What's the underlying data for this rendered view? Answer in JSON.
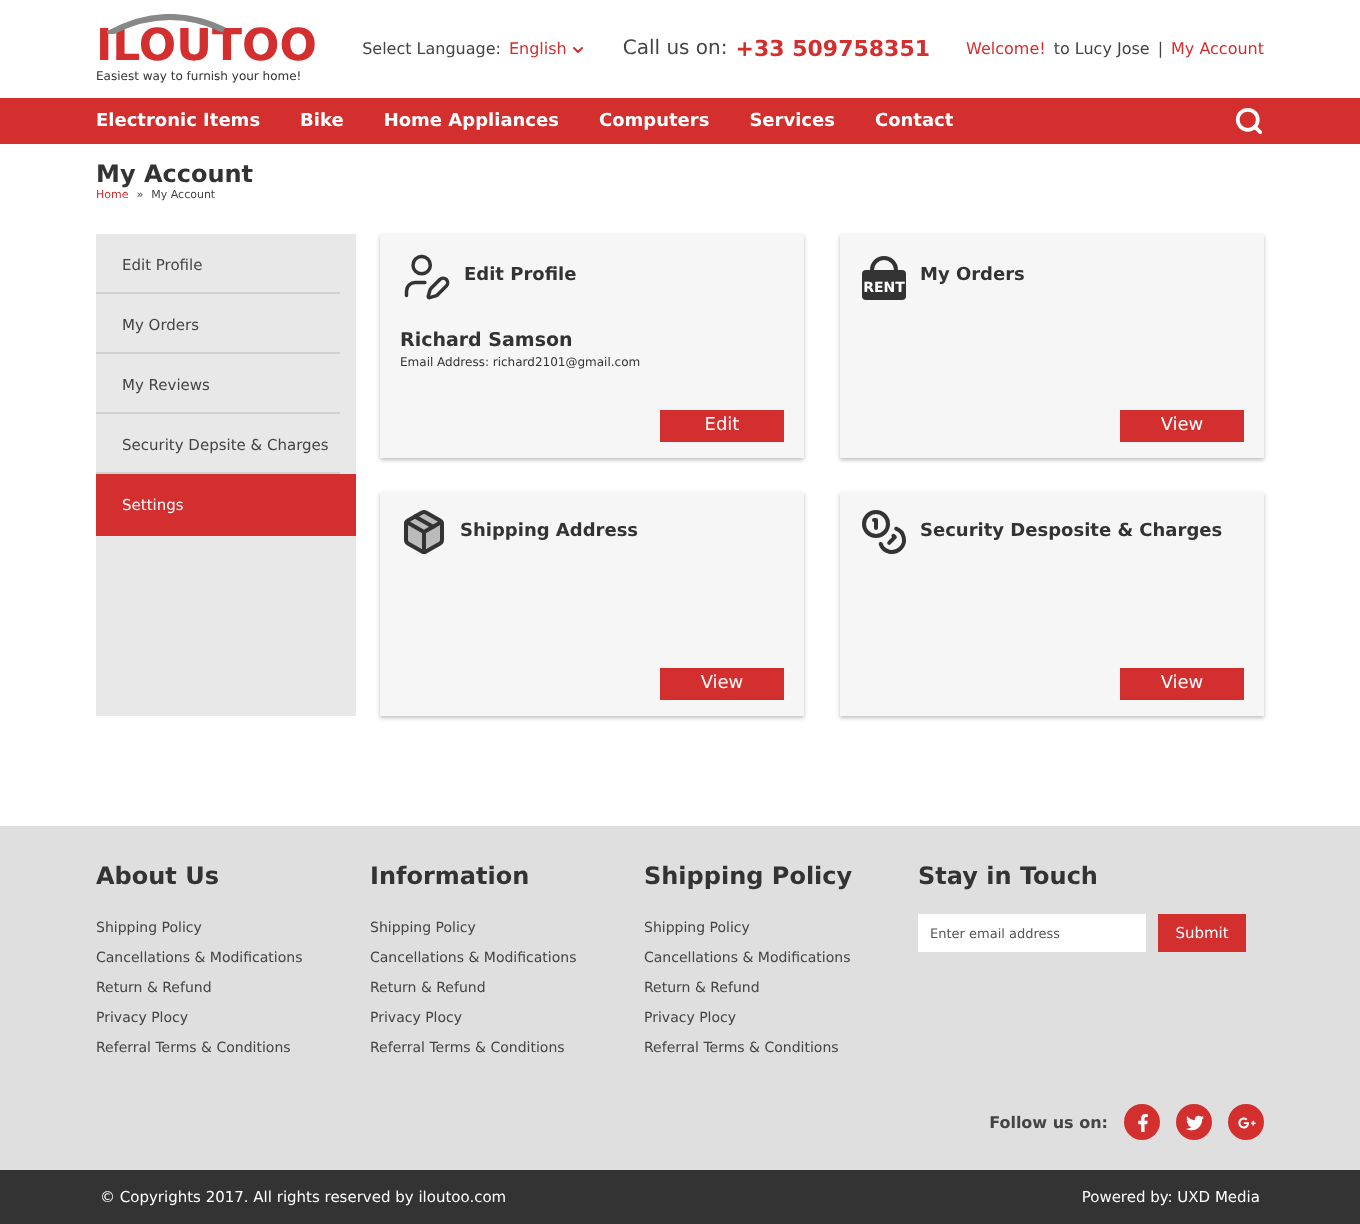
{
  "logo": {
    "name": "ILOUTOO",
    "tagline": "Easiest way to furnish your home!"
  },
  "header": {
    "language_label": "Select Language:",
    "language": "English",
    "call_label": "Call us on:",
    "phone": "+33 509758351",
    "welcome": "Welcome!",
    "welcome_rest": "to Lucy Jose",
    "separator": "|",
    "account_link": "My Account"
  },
  "nav": {
    "items": [
      "Electronic Items",
      "Bike",
      "Home Appliances",
      "Computers",
      "Services",
      "Contact"
    ]
  },
  "page": {
    "title": "My Account",
    "breadcrumb": [
      {
        "label": "Home",
        "link": true
      },
      {
        "label": "»",
        "link": false
      },
      {
        "label": "My Account",
        "link": false
      }
    ]
  },
  "sidebar": {
    "items": [
      {
        "label": "Edit Profile",
        "selected": false
      },
      {
        "label": "My Orders",
        "selected": false
      },
      {
        "label": "My Reviews",
        "selected": false
      },
      {
        "label": "Security Depsite & Charges",
        "selected": false
      },
      {
        "label": "Settings",
        "selected": true
      }
    ]
  },
  "cards": [
    {
      "kind": "profile",
      "title": "Edit Profile",
      "name": "Richard Samson",
      "email": "Email Address: richard2101@gmail.com",
      "button": "Edit"
    },
    {
      "kind": "orders",
      "title": "My Orders",
      "icon_text": "RENT",
      "button": "View"
    },
    {
      "kind": "shipping",
      "title": "Shipping Address",
      "button": "View"
    },
    {
      "kind": "deposit",
      "title": "Security Desposite & Charges",
      "button": "View"
    }
  ],
  "footer": {
    "columns": [
      {
        "title": "About Us",
        "links": [
          "Shipping Policy",
          "Cancellations & Modifications",
          "Return & Refund",
          "Privacy Plocy",
          "Referral Terms & Conditions"
        ]
      },
      {
        "title": "Information",
        "links": [
          "Shipping Policy",
          "Cancellations & Modifications",
          "Return & Refund",
          "Privacy Plocy",
          "Referral Terms & Conditions"
        ]
      },
      {
        "title": "Shipping Policy",
        "links": [
          "Shipping Policy",
          "Cancellations & Modifications",
          "Return & Refund",
          "Privacy Plocy",
          "Referral Terms & Conditions"
        ]
      }
    ],
    "newsletter": {
      "title": "Stay in Touch",
      "placeholder": "Enter email address",
      "button": "Submit"
    },
    "follow_label": "Follow us on:",
    "social": [
      {
        "kind": "facebook"
      },
      {
        "kind": "twitter"
      },
      {
        "kind": "googleplus"
      }
    ]
  },
  "bottom_bar": {
    "copyright": "© Copyrights 2017. All rights reserved by iloutoo.com",
    "powered": "Powered by: UXD Media"
  }
}
